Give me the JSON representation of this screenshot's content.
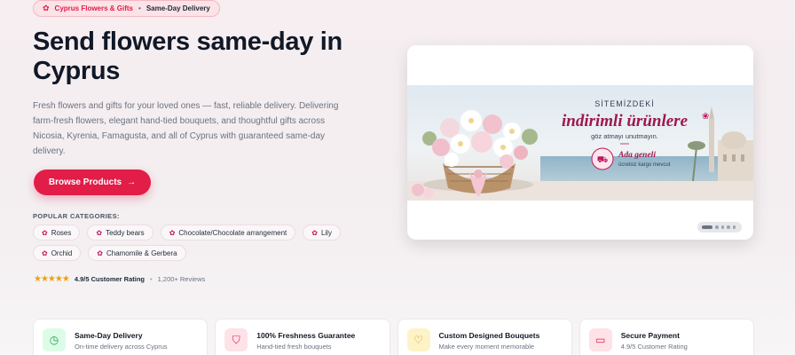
{
  "badge": {
    "icon": "flower-icon",
    "first": "Cyprus Flowers & Gifts",
    "separator": "•",
    "second": "Same-Day Delivery"
  },
  "hero": {
    "title": "Send flowers same-day in Cyprus",
    "description": "Fresh flowers and gifts for your loved ones — fast, reliable delivery. Delivering farm-fresh flowers, elegant hand-tied bouquets, and thoughtful gifts across Nicosia, Kyrenia, Famagusta, and all of Cyprus with guaranteed same-day delivery.",
    "browse_label": "Browse Products",
    "browse_arrow": "→"
  },
  "categories": {
    "label": "POPULAR CATEGORIES:",
    "items": [
      "Roses",
      "Teddy bears",
      "Chocolate/Chocolate arrangement",
      "Lily",
      "Orchid",
      "Chamomile & Gerbera"
    ]
  },
  "rating": {
    "stars": "★★★★★",
    "text": "4.9/5 Customer Rating",
    "separator": "•",
    "reviews": "1,200+ Reviews"
  },
  "banner": {
    "line1": "SİTEMİZDEKİ",
    "line2": "indirimli ürünlere",
    "line3": "göz atmayı unutmayın.",
    "badge_title": "Ada geneli",
    "badge_sub": "ücretsiz kargo mevcut",
    "slides_total": 5,
    "slide_active": 1
  },
  "features": [
    {
      "icon": "clock-icon",
      "glyph": "◷",
      "title": "Same-Day Delivery",
      "subtitle": "On-time delivery across Cyprus",
      "bg": "#dcfce7",
      "fg": "#16a34a"
    },
    {
      "icon": "shield-icon",
      "glyph": "⛉",
      "title": "100% Freshness Guarantee",
      "subtitle": "Hand-tied fresh bouquets",
      "bg": "#fde2e8",
      "fg": "#e11d48"
    },
    {
      "icon": "heart-icon",
      "glyph": "♡",
      "title": "Custom Designed Bouquets",
      "subtitle": "Make every moment memorable",
      "bg": "#fef3c7",
      "fg": "#d97706"
    },
    {
      "icon": "card-icon",
      "glyph": "▭",
      "title": "Secure Payment",
      "subtitle": "4.9/5 Customer Rating",
      "bg": "#fde2e8",
      "fg": "#e11d48"
    }
  ],
  "colors": {
    "accent": "#e11d48",
    "star": "#f59e0b"
  }
}
